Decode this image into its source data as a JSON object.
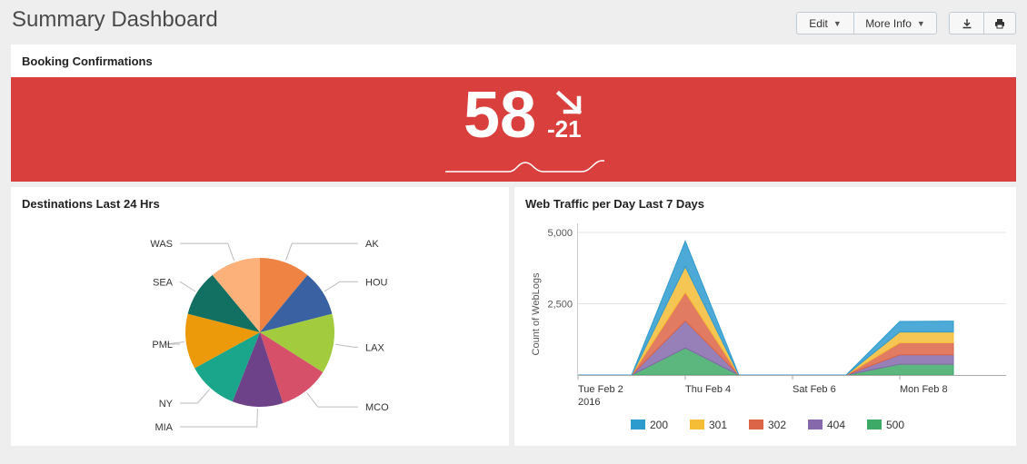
{
  "page": {
    "title": "Summary Dashboard",
    "edit_label": "Edit",
    "more_info_label": "More Info",
    "export_icon": "download-icon",
    "print_icon": "print-icon"
  },
  "booking": {
    "title": "Booking Confirmations",
    "value": "58",
    "delta": "-21",
    "trend": "down",
    "color": "#d93f3c"
  },
  "destinations": {
    "title": "Destinations Last 24 Hrs",
    "chart_data": {
      "type": "pie",
      "labels": [
        "AK",
        "HOU",
        "LAX",
        "MCO",
        "MIA",
        "NY",
        "PML",
        "SEA",
        "WAS"
      ],
      "values": [
        11,
        10,
        13,
        11,
        11,
        11,
        12,
        10,
        11
      ],
      "colors": [
        "#ef8343",
        "#3a62a2",
        "#a2cc3e",
        "#d6506a",
        "#6d4288",
        "#1aa68a",
        "#ec9a0a",
        "#127063",
        "#fcb07a"
      ]
    }
  },
  "traffic": {
    "title": "Web Traffic per Day Last 7 Days",
    "chart_data": {
      "type": "area",
      "stacked": true,
      "ylabel": "Count of WebLogs",
      "ylim": [
        0,
        5000
      ],
      "yticks": [
        "5,000",
        "2,500"
      ],
      "ytick_values": [
        5000,
        2500
      ],
      "xticks": [
        "Tue Feb 2\n2016",
        "Thu Feb 4",
        "Sat Feb 6",
        "Mon Feb 8"
      ],
      "x": [
        "2016-02-02",
        "2016-02-03",
        "2016-02-04",
        "2016-02-05",
        "2016-02-06",
        "2016-02-07",
        "2016-02-08",
        "2016-02-09"
      ],
      "series": [
        {
          "name": "500",
          "color": "#3eaa67",
          "values": [
            0,
            0,
            950,
            0,
            0,
            0,
            380,
            380
          ]
        },
        {
          "name": "404",
          "color": "#8569aa",
          "values": [
            0,
            0,
            950,
            0,
            0,
            0,
            330,
            330
          ]
        },
        {
          "name": "302",
          "color": "#dc6548",
          "values": [
            0,
            0,
            1000,
            0,
            0,
            0,
            420,
            420
          ]
        },
        {
          "name": "301",
          "color": "#f5bc36",
          "values": [
            0,
            0,
            900,
            0,
            0,
            0,
            380,
            380
          ]
        },
        {
          "name": "200",
          "color": "#2e9bcf",
          "values": [
            0,
            0,
            900,
            0,
            0,
            0,
            370,
            380
          ]
        }
      ],
      "legend_order": [
        "200",
        "301",
        "302",
        "404",
        "500"
      ],
      "legend": "bottom"
    }
  }
}
